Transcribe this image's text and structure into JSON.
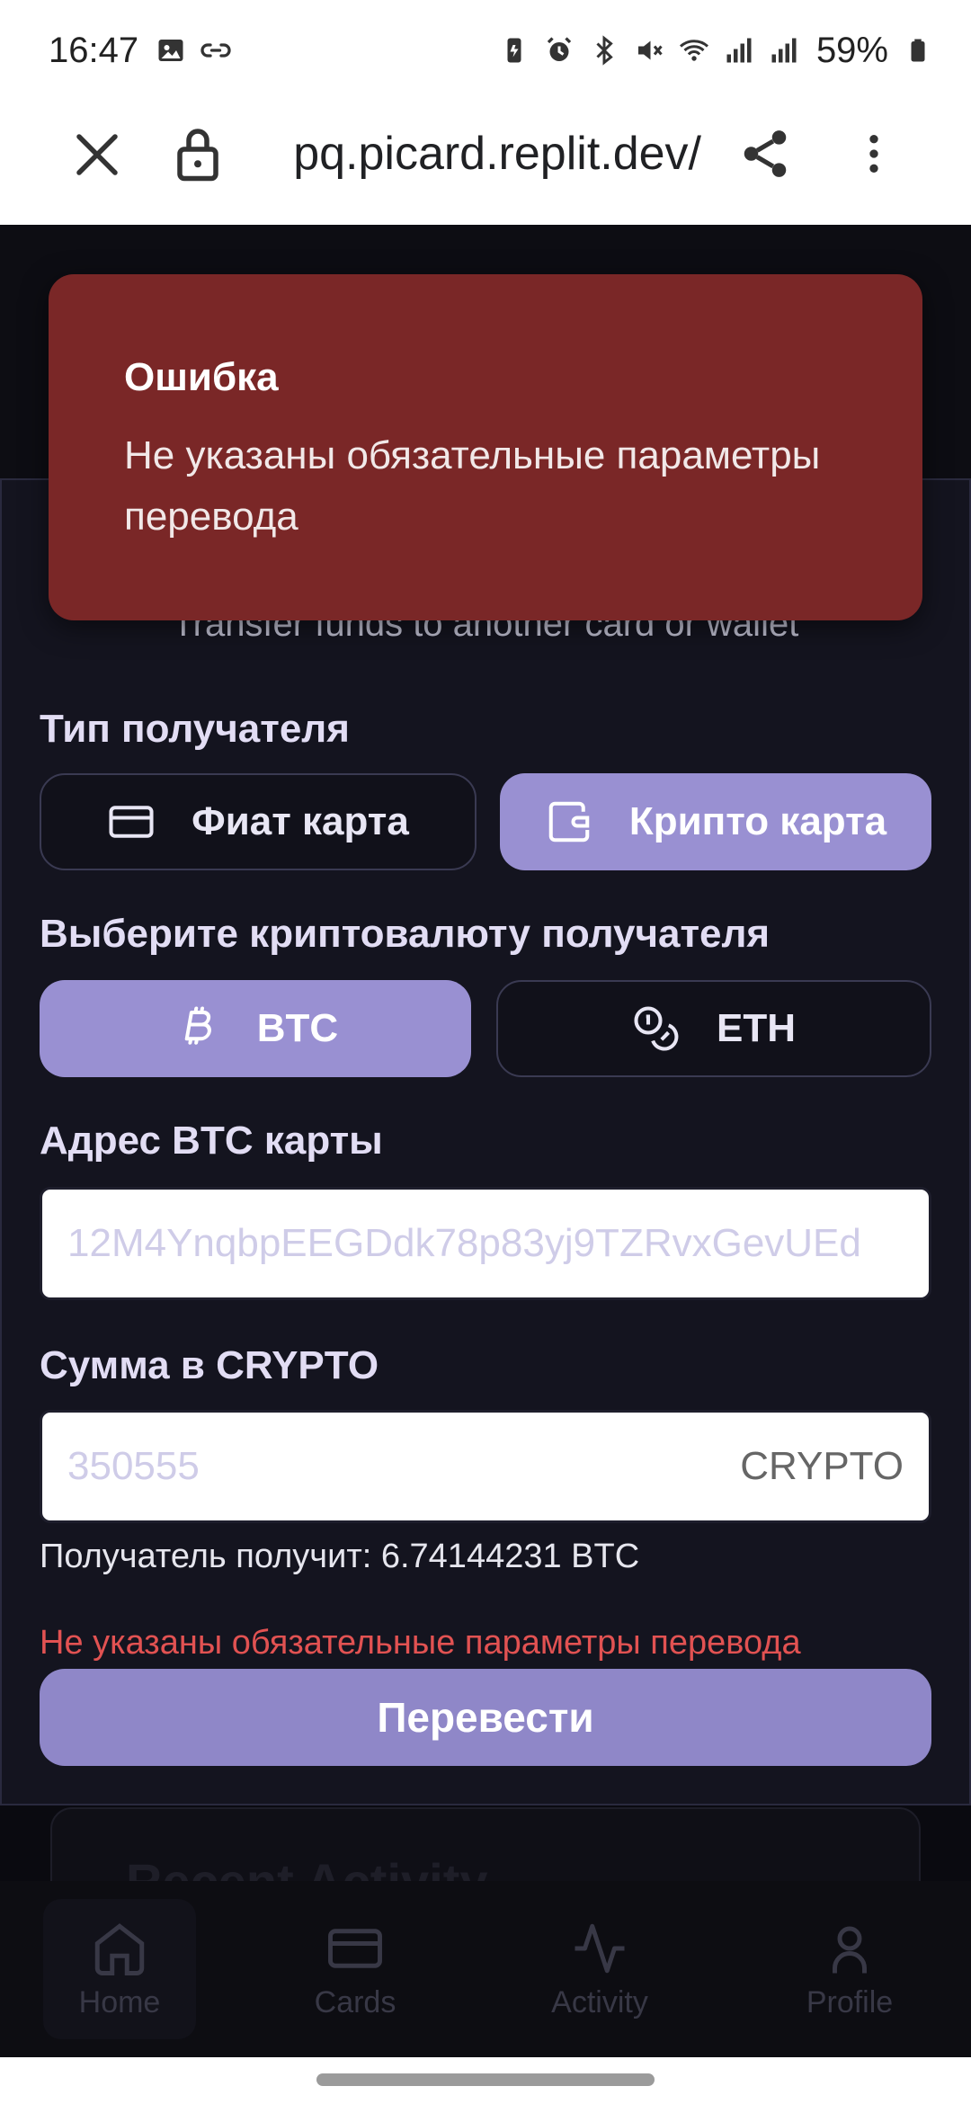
{
  "status_bar": {
    "time": "16:47",
    "battery": "59%"
  },
  "browser": {
    "url": "pq.picard.replit.dev/"
  },
  "transfer": {
    "subtitle": "Transfer funds to another card or wallet",
    "recipient_type_label": "Тип получателя",
    "fiat_option": "Фиат карта",
    "crypto_option": "Крипто карта",
    "crypto_select_label": "Выберите криптовалюту получателя",
    "btc_option": "BTC",
    "eth_option": "ETH",
    "address_label": "Адрес BTC карты",
    "address_placeholder": "12M4YnqbpEEGDdk78p83yj9TZRvxGevUEd",
    "amount_label": "Сумма в CRYPTO",
    "amount_placeholder": "350555",
    "amount_suffix": "CRYPTO",
    "recipient_receives": "Получатель получит: 6.74144231 BTC",
    "error_text": "Не указаны обязательные параметры перевода",
    "submit_label": "Перевести"
  },
  "recent": {
    "title": "Recent Activity"
  },
  "toast": {
    "title": "Ошибка",
    "message": "Не указаны обязательные параметры перевода"
  },
  "nav": {
    "home": "Home",
    "cards": "Cards",
    "activity": "Activity",
    "profile": "Profile"
  },
  "colors": {
    "accent": "#9990d2",
    "toast_bg": "#7a2727",
    "error": "#e25252"
  }
}
